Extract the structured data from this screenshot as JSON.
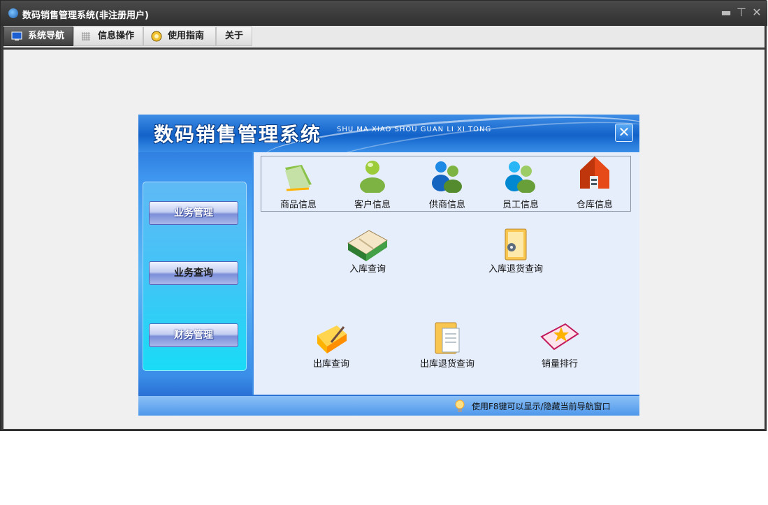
{
  "window": {
    "title": "数码销售管理系统(非注册用户)",
    "controls": [
      "minimize-icon",
      "restore-icon",
      "close-icon"
    ]
  },
  "tabs": [
    {
      "label": "系统导航",
      "icon": "monitor-icon",
      "active": true
    },
    {
      "label": "信息操作",
      "icon": "grid-icon",
      "active": false
    },
    {
      "label": "使用指南",
      "icon": "help-disc-icon",
      "active": false
    },
    {
      "label": "关于",
      "icon": "",
      "active": false
    }
  ],
  "panel": {
    "title": "数码销售管理系统",
    "subtitle": "SHU MA XIAO SHOU GUAN LI XI TONG",
    "nav_buttons": [
      "业务管理",
      "业务查询",
      "财务管理"
    ],
    "info_items": [
      "商品信息",
      "客户信息",
      "供商信息",
      "员工信息",
      "仓库信息"
    ],
    "query_items": [
      "入库查询",
      "入库退货查询",
      "出库查询",
      "出库退货查询",
      "销量排行"
    ],
    "hint": "使用F8键可以显示/隐藏当前导航窗口"
  },
  "colors": {
    "accent": "#1262c9",
    "titlebar": "#2f2f2f",
    "panel_bg": "#e7eefb"
  }
}
